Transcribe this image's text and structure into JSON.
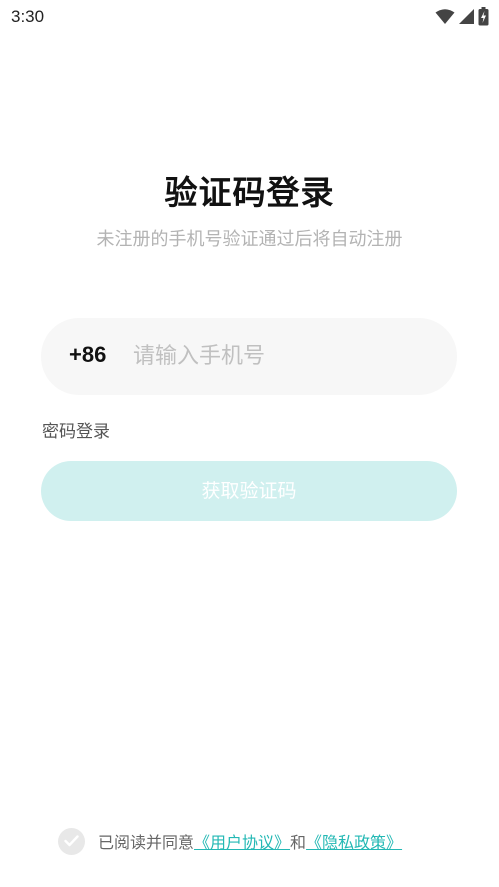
{
  "status_bar": {
    "time": "3:30",
    "icons": [
      "wifi-icon",
      "cell-signal-icon",
      "battery-charging-icon"
    ]
  },
  "login": {
    "title": "验证码登录",
    "subtitle": "未注册的手机号验证通过后将自动注册",
    "country_code": "+86",
    "phone_placeholder": "请输入手机号",
    "phone_value": "",
    "password_login_label": "密码登录",
    "get_code_label": "获取验证码"
  },
  "agreement": {
    "checked": false,
    "prefix": "已阅读并同意",
    "user_agreement": "《用户协议》",
    "and": "和",
    "privacy_policy": "《隐私政策》"
  },
  "colors": {
    "accent": "#23b8b4",
    "button_disabled_bg": "#d0f0ef",
    "input_bg": "#f7f7f7",
    "placeholder": "#c0c0c0"
  }
}
